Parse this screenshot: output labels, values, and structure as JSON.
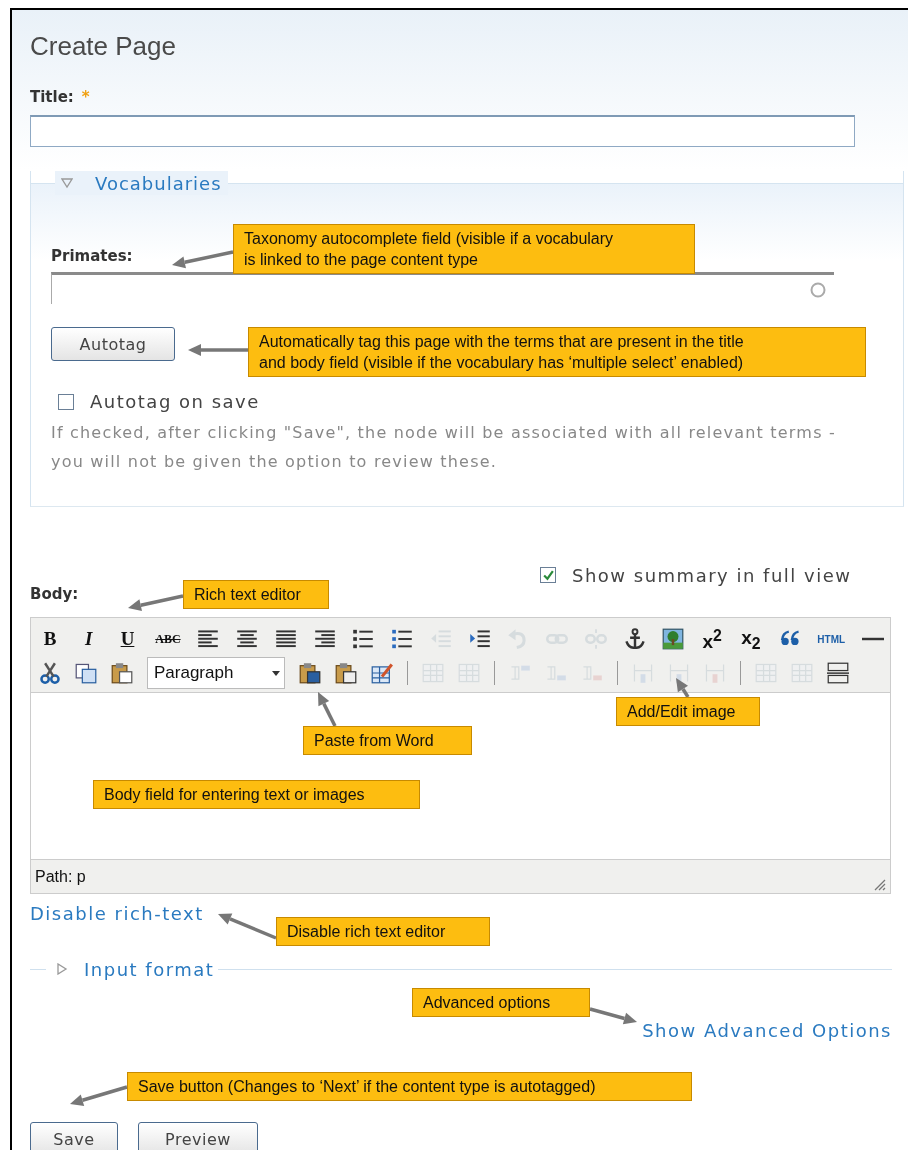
{
  "page_title": "Create Page",
  "title_field": {
    "label": "Title:",
    "required_mark": "*"
  },
  "vocabularies": {
    "legend": "Vocabularies",
    "expanded": true,
    "field_label": "Primates:",
    "autotag_button": "Autotag",
    "autotag_on_save": {
      "label": "Autotag on save",
      "checked": false
    },
    "description": "If checked, after clicking \"Save\", the node will be associated with all relevant terms - you will not be given the option to review these."
  },
  "show_summary": {
    "label": "Show summary in full view",
    "checked": true
  },
  "body": {
    "label": "Body:",
    "path": "Path: p",
    "toolbar_rows": [
      [
        {
          "kind": "bold",
          "label": "B",
          "disabled": false
        },
        {
          "kind": "italic",
          "label": "I",
          "disabled": false
        },
        {
          "kind": "underline",
          "label": "U",
          "disabled": false
        },
        {
          "kind": "strike",
          "label": "ABC",
          "disabled": false
        },
        {
          "kind": "alignleft",
          "disabled": false
        },
        {
          "kind": "aligncenter",
          "disabled": false
        },
        {
          "kind": "justify",
          "disabled": false
        },
        {
          "kind": "alignright",
          "disabled": false
        },
        {
          "kind": "bullets",
          "disabled": false
        },
        {
          "kind": "numbers",
          "disabled": false
        },
        {
          "kind": "outdent",
          "disabled": true
        },
        {
          "kind": "indent",
          "disabled": false
        },
        {
          "kind": "undo",
          "disabled": true
        },
        {
          "kind": "link",
          "disabled": true
        },
        {
          "kind": "unlink",
          "disabled": true
        },
        {
          "kind": "anchor",
          "disabled": false
        },
        {
          "kind": "image",
          "disabled": false
        },
        {
          "kind": "superscript",
          "label": "x$^{2}$",
          "disabled": false
        },
        {
          "kind": "subscript",
          "label": "x$_{2}$",
          "disabled": false
        },
        {
          "kind": "quote",
          "disabled": false
        },
        {
          "kind": "html",
          "label": "HTML",
          "disabled": false
        },
        {
          "kind": "rule",
          "disabled": false
        }
      ],
      [
        {
          "kind": "cut",
          "disabled": false
        },
        {
          "kind": "copy",
          "disabled": false
        },
        {
          "kind": "paste",
          "disabled": false
        },
        {
          "kind": "format",
          "label": "Paragraph",
          "disabled": false
        },
        {
          "kind": "pasteword",
          "disabled": false
        },
        {
          "kind": "pastetext",
          "disabled": false
        },
        {
          "kind": "edit",
          "disabled": false
        },
        {
          "kind": "separator"
        },
        {
          "kind": "tablerow",
          "disabled": true
        },
        {
          "kind": "tablecell",
          "disabled": true
        },
        {
          "kind": "separator"
        },
        {
          "kind": "rowbefore",
          "disabled": true
        },
        {
          "kind": "rowafter",
          "disabled": true
        },
        {
          "kind": "rowdelete",
          "disabled": true
        },
        {
          "kind": "separator"
        },
        {
          "kind": "colbefore",
          "disabled": true
        },
        {
          "kind": "colafter",
          "disabled": true
        },
        {
          "kind": "coldelete",
          "disabled": true
        },
        {
          "kind": "separator"
        },
        {
          "kind": "table",
          "disabled": true
        },
        {
          "kind": "tableprops",
          "disabled": true
        },
        {
          "kind": "pagebreak",
          "disabled": false
        }
      ]
    ]
  },
  "disable_link": "Disable rich-text",
  "input_format": {
    "legend": "Input format",
    "expanded": false
  },
  "advanced_link": "Show Advanced Options",
  "buttons": [
    "Save",
    "Preview"
  ],
  "callouts": [
    "Taxonomy autocomplete field (visible if a vocabulary\nis linked to the page content type",
    "Automatically tag this page with the terms that are present in the title\nand body field (visible if the vocabulary has ‘multiple select’ enabled)",
    "Rich text editor",
    "Add/Edit image",
    "Paste from Word",
    "Body field for entering text or images",
    "Disable rich text editor",
    "Advanced options",
    "Save button (Changes to ‘Next’ if the content type is autotagged)"
  ]
}
